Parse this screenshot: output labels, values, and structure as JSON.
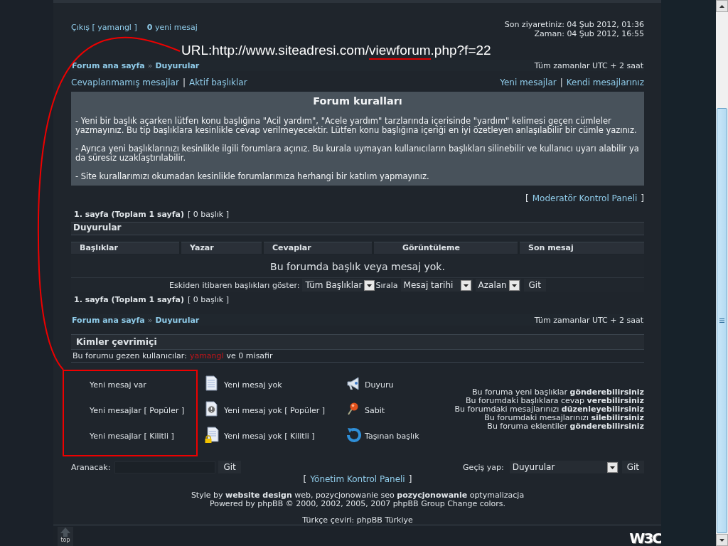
{
  "header": {
    "logout": "Çıkış",
    "bracket_open": "[",
    "username": "yamangl",
    "bracket_close": "]",
    "new_count": "0",
    "new_label": "yeni mesaj",
    "last_visit": "Son ziyaretiniz: 04 Şub 2012, 01:36",
    "current_time": "Zaman: 04 Şub 2012, 16:55"
  },
  "annotation": {
    "url_prefix": "URL:http://www.siteadresi.com/",
    "url_highlight": "viewforum",
    "url_suffix": ".php?f=22"
  },
  "breadcrumbs_top": {
    "items": [
      "Forum ana sayfa",
      "Duyurular"
    ],
    "separator": "»",
    "timezone": "Tüm zamanlar UTC + 2 saat"
  },
  "quick_links": {
    "left": [
      "Cevaplanmamış mesajlar",
      "Aktif başlıklar"
    ],
    "right": [
      "Yeni mesajlar",
      "Kendi mesajlarınız"
    ],
    "separator": "|"
  },
  "rules": {
    "title": "Forum kuralları",
    "paragraphs": [
      "- Yeni bir başlık açarken lütfen konu başlığına \"Acil yardım\", \"Acele yardım\" tarzlarında içerisinde \"yardım\" kelimesi geçen cümleler yazmayınız. Bu tip başlıklara kesinlikle cevap verilmeyecektir. Lütfen konu başlığına içeriği en iyi özetleyen anlaşılabilir bir cümle yazınız.",
      "- Ayrıca yeni başlıklarınızı kesinlikle ilgili forumlara açınız. Bu kurala uymayan kullanıcıların başlıkları silinebilir ve kullanıcı uyarı alabilir ya da süresiz uzaklaştırılabilir.",
      "- Site kurallarımızı okumadan kesinlikle forumlarımıza herhangi bir katılım yapmayınız."
    ]
  },
  "moderator_link": {
    "open": "[",
    "label": "Moderatör Kontrol Paneli",
    "close": "]"
  },
  "pagination_top": {
    "pages": "1. sayfa (Toplam 1 sayfa)",
    "topics": "[ 0 başlık ]"
  },
  "topic_table": {
    "title": "Duyurular",
    "columns": [
      "Başlıklar",
      "Yazar",
      "Cevaplar",
      "Görüntüleme",
      "Son mesaj"
    ],
    "empty_message": "Bu forumda başlık veya mesaj yok.",
    "sort": {
      "show_label": "Eskiden itibaren başlıkları göster:",
      "show_value": "Tüm Başlıklar",
      "sort_label": "Sırala",
      "sort_value": "Mesaj tarihi",
      "order_value": "Azalan",
      "button": "Git"
    }
  },
  "pagination_bottom": {
    "pages": "1. sayfa (Toplam 1 sayfa)",
    "topics": "[ 0 başlık ]"
  },
  "breadcrumbs_bottom": {
    "items": [
      "Forum ana sayfa",
      "Duyurular"
    ],
    "separator": "»",
    "timezone": "Tüm zamanlar UTC + 2 saat"
  },
  "online": {
    "title": "Kimler çevrimiçi",
    "label": "Bu forumu gezen kullanıcılar:",
    "user": "yamangl",
    "rest": "ve 0 misafir"
  },
  "legend": [
    {
      "kind": "none",
      "label": "Yeni mesaj var"
    },
    {
      "kind": "none",
      "label": "Yeni mesajlar [ Popüler ]"
    },
    {
      "kind": "none",
      "label": "Yeni mesajlar [ Kilitli ]"
    },
    {
      "kind": "doc",
      "label": "Yeni mesaj yok"
    },
    {
      "kind": "doc-hot",
      "label": "Yeni mesaj yok [ Popüler ]"
    },
    {
      "kind": "doc-locked",
      "label": "Yeni mesaj yok [ Kilitli ]"
    },
    {
      "kind": "announce",
      "label": "Duyuru"
    },
    {
      "kind": "sticky",
      "label": "Sabit"
    },
    {
      "kind": "moved",
      "label": "Taşınan başlık"
    }
  ],
  "permissions": [
    "Bu foruma yeni başlıklar **gönderebilirsiniz**",
    "Bu forumdaki başlıklara cevap **verebilirsiniz**",
    "Bu forumdaki mesajlarınızı **düzenleyebilirsiniz**",
    "Bu forumdaki mesajlarınızı **silebilirsiniz**",
    "Bu foruma eklentiler **gönderebilirsiniz**"
  ],
  "search": {
    "label": "Aranacak:",
    "button": "Git"
  },
  "jump": {
    "label": "Geçiş yap:",
    "value": "Duyurular",
    "button": "Git"
  },
  "admin_link": {
    "open": "[",
    "label": "Yönetim Kontrol Paneli",
    "close": "]"
  },
  "footer": {
    "lines": [
      "Style by **website design** web, pozycjonowanie seo **pozycjonowanie** optymalizacja",
      "Powered by phpBB © 2000, 2002, 2005, 2007 phpBB Group Change colors."
    ],
    "translation": "Türkçe çeviri: phpBB Türkiye"
  },
  "bottom_bar": {
    "top_label": "top",
    "logo": "W3C"
  }
}
